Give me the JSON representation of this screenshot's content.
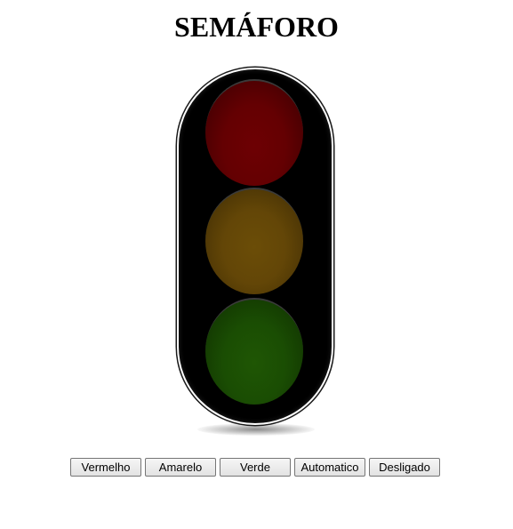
{
  "page": {
    "title": "SEMÁFORO"
  },
  "traffic_light": {
    "lamps": [
      {
        "color_name": "red",
        "color": "#640002",
        "state": "off"
      },
      {
        "color_name": "yellow",
        "color": "#634607",
        "state": "off"
      },
      {
        "color_name": "green",
        "color": "#1a4d03",
        "state": "off"
      }
    ],
    "body_color": "#000000"
  },
  "controls": {
    "buttons": [
      {
        "label": "Vermelho"
      },
      {
        "label": "Amarelo"
      },
      {
        "label": "Verde"
      },
      {
        "label": "Automatico"
      },
      {
        "label": "Desligado"
      }
    ]
  }
}
